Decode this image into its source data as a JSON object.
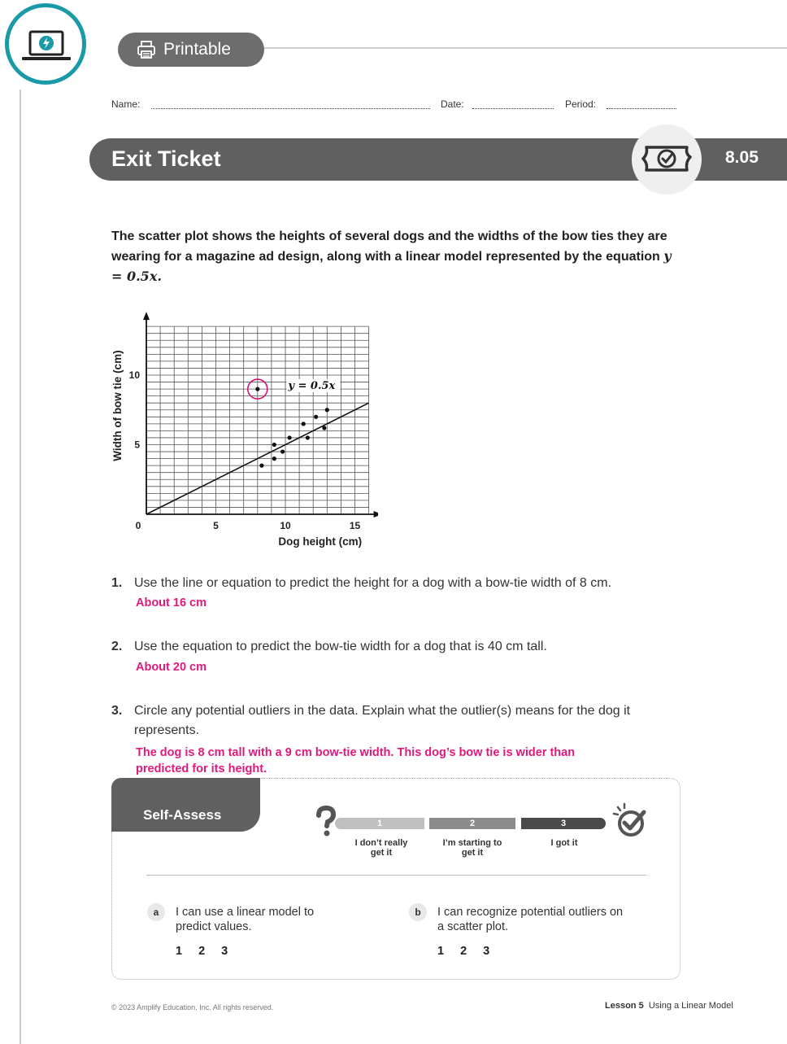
{
  "header": {
    "logo_icon": "laptop-lightning-icon",
    "printable_label": "Printable",
    "printer_icon": "printer-icon",
    "name_label": "Name:",
    "date_label": "Date:",
    "period_label": "Period:"
  },
  "exit_ticket": {
    "title": "Exit Ticket",
    "ticket_icon": "ticket-check-icon",
    "lesson_number": "8.05"
  },
  "prompt": {
    "text": "The scatter plot shows the heights of several dogs and the widths of the bow ties they are wearing for a magazine ad design, along with a linear model represented by the equation ",
    "equation": "y = 0.5x."
  },
  "chart_data": {
    "type": "scatter",
    "xlabel": "Dog height (cm)",
    "ylabel": "Width of bow tie (cm)",
    "xlim": [
      0,
      16
    ],
    "ylim": [
      0,
      13.5
    ],
    "x_ticks": [
      0,
      5,
      10,
      15
    ],
    "y_ticks": [
      5,
      10
    ],
    "grid": true,
    "points": [
      {
        "x": 8,
        "y": 9
      },
      {
        "x": 8.3,
        "y": 3.5
      },
      {
        "x": 9.2,
        "y": 4
      },
      {
        "x": 9.2,
        "y": 5
      },
      {
        "x": 9.8,
        "y": 4.5
      },
      {
        "x": 10.3,
        "y": 5.5
      },
      {
        "x": 11.3,
        "y": 6.5
      },
      {
        "x": 11.6,
        "y": 5.5
      },
      {
        "x": 12.2,
        "y": 7
      },
      {
        "x": 12.8,
        "y": 6.2
      },
      {
        "x": 13,
        "y": 7.5
      }
    ],
    "line": {
      "slope": 0.5,
      "intercept": 0,
      "label": "y = 0.5x"
    },
    "circled_point": {
      "x": 8,
      "y": 9
    },
    "accent_color": "#d6106f"
  },
  "questions": [
    {
      "number": "1.",
      "text": "Use the line or equation to predict the height for a dog with a bow-tie width of 8 cm.",
      "answer": "About 16 cm"
    },
    {
      "number": "2.",
      "text": "Use the equation to predict the bow-tie width for a dog that is 40 cm tall.",
      "answer": "About 20 cm"
    },
    {
      "number": "3.",
      "text": "Circle any potential outliers in the data. Explain what the outlier(s) means for the dog it represents.",
      "answer": "The dog is 8 cm tall with a 9 cm bow-tie width. This dog’s bow tie is wider than predicted for its height."
    }
  ],
  "self_assess": {
    "title": "Self-Assess",
    "question_icon": "question-mark-icon",
    "check_icon": "sparkle-check-icon",
    "scale": [
      {
        "label": "1",
        "caption": "I don’t really get it",
        "color": "#bfbfbf"
      },
      {
        "label": "2",
        "caption": "I’m starting to get it",
        "color": "#8c8c8c"
      },
      {
        "label": "3",
        "caption": "I got it",
        "color": "#4a4a4a"
      }
    ],
    "items": [
      {
        "letter": "a",
        "text": "I can use a linear model to predict values.",
        "ratings": [
          "1",
          "2",
          "3"
        ]
      },
      {
        "letter": "b",
        "text": "I can recognize potential outliers on a scatter plot.",
        "ratings": [
          "1",
          "2",
          "3"
        ]
      }
    ]
  },
  "footer": {
    "copyright": "© 2023 Amplify Education, Inc. All rights reserved.",
    "lesson_label": "Lesson 5",
    "lesson_title": "Using a Linear Model"
  }
}
